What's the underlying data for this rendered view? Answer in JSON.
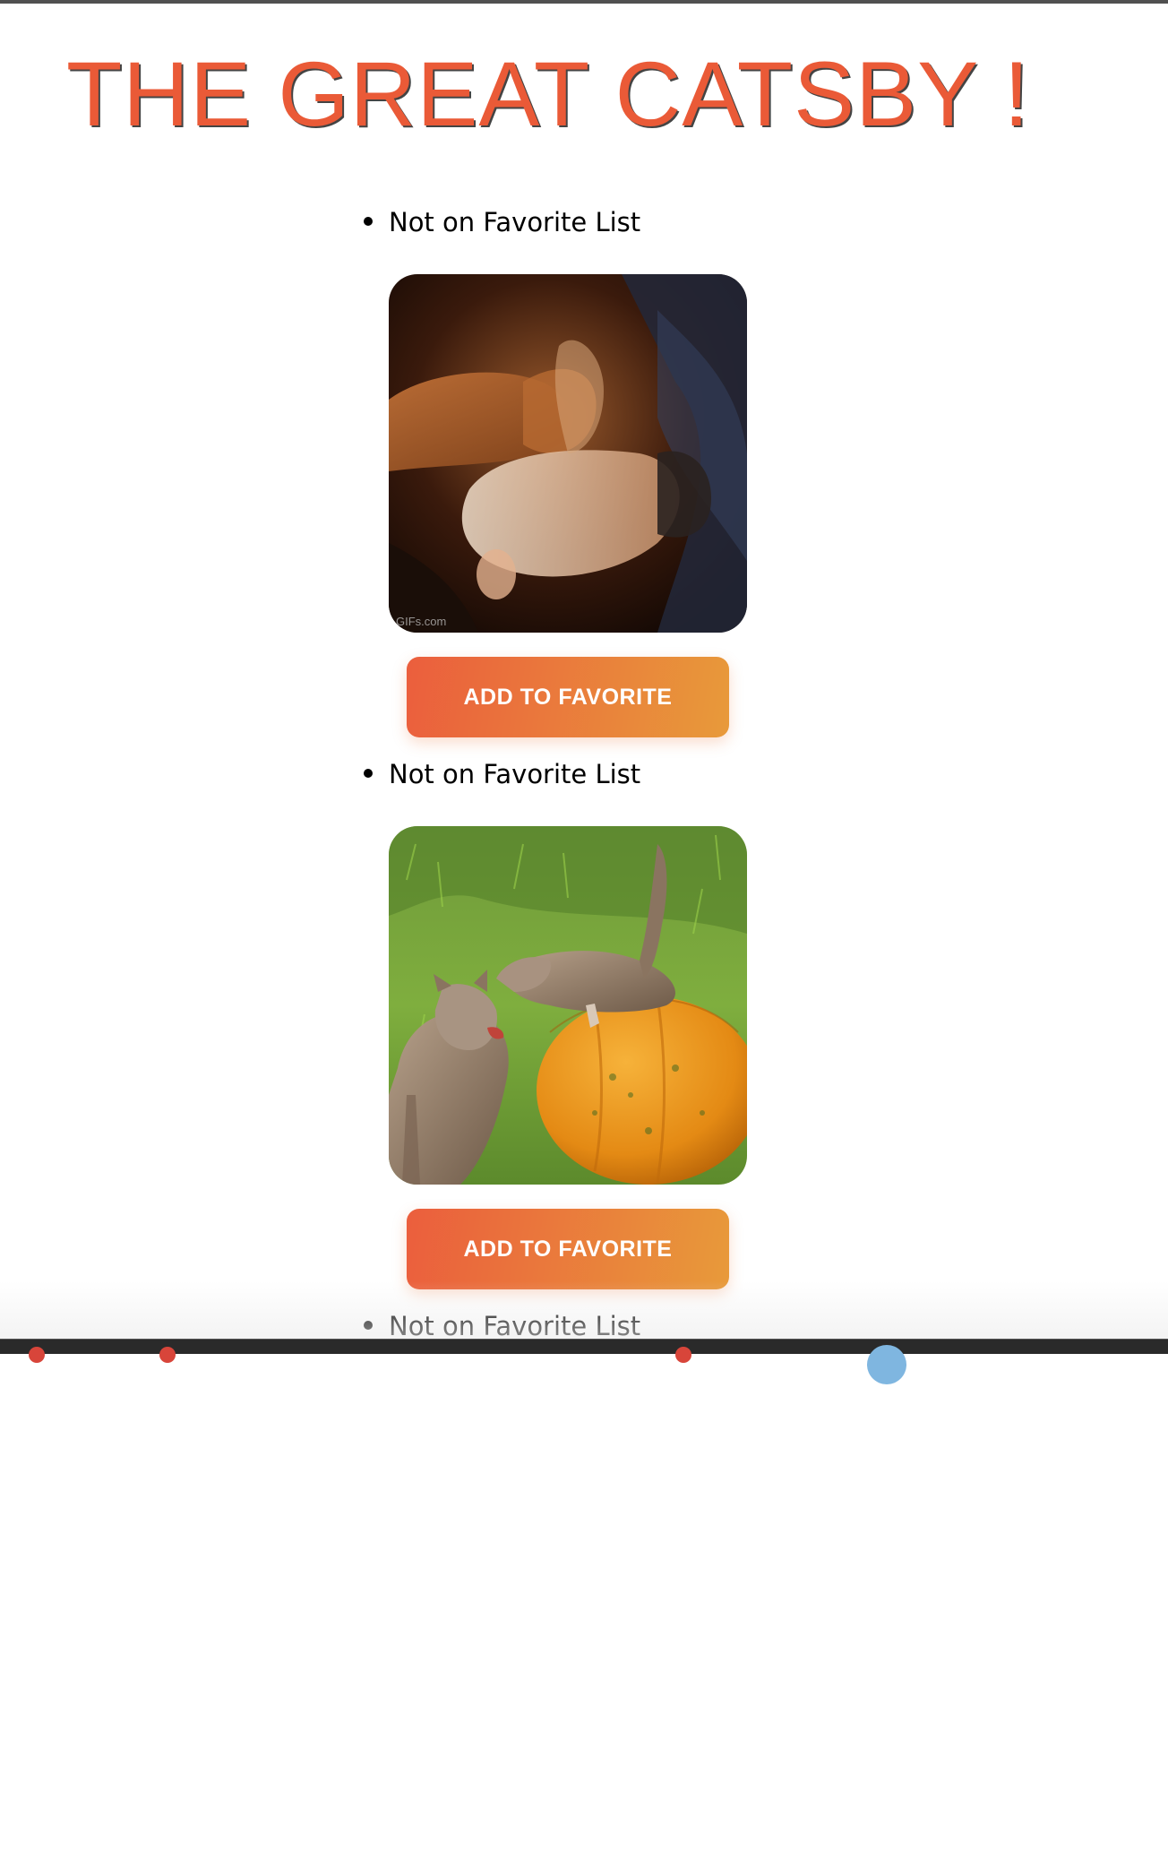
{
  "page": {
    "title": "THE GREAT CATSBY !"
  },
  "cats": [
    {
      "status": "Not on Favorite List",
      "image_icon": "cat-gif-image",
      "button_label": "ADD TO FAVORITE",
      "watermark": "GIFs.com"
    },
    {
      "status": "Not on Favorite List",
      "image_icon": "kittens-pumpkin-image",
      "button_label": "ADD TO FAVORITE"
    },
    {
      "status": "Not on Favorite List"
    }
  ],
  "colors": {
    "title": "#ea5a37",
    "button_start": "#eb5e3d",
    "button_end": "#e89a3a"
  }
}
